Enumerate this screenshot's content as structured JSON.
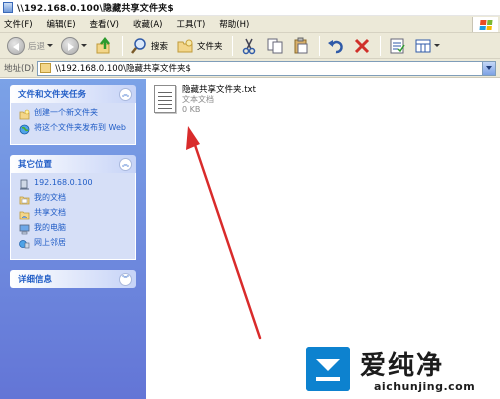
{
  "window": {
    "title": "\\\\192.168.0.100\\隐藏共享文件夹$"
  },
  "menu": [
    {
      "label": "文件(F)"
    },
    {
      "label": "编辑(E)"
    },
    {
      "label": "查看(V)"
    },
    {
      "label": "收藏(A)"
    },
    {
      "label": "工具(T)"
    },
    {
      "label": "帮助(H)"
    }
  ],
  "toolbar": {
    "back_label": "后退",
    "search_label": "搜索",
    "folders_label": "文件夹"
  },
  "address": {
    "label": "地址(D)",
    "value": "\\\\192.168.0.100\\隐藏共享文件夹$"
  },
  "taskpane": {
    "file_tasks": {
      "title": "文件和文件夹任务",
      "items": [
        {
          "label": "创建一个新文件夹"
        },
        {
          "label": "将这个文件夹发布到 Web"
        }
      ]
    },
    "other_places": {
      "title": "其它位置",
      "items": [
        {
          "label": "192.168.0.100"
        },
        {
          "label": "我的文档"
        },
        {
          "label": "共享文档"
        },
        {
          "label": "我的电脑"
        },
        {
          "label": "网上邻居"
        }
      ]
    },
    "details": {
      "title": "详细信息"
    }
  },
  "files": [
    {
      "name": "隐藏共享文件夹.txt",
      "type": "文本文档",
      "size": "0 KB"
    }
  ],
  "watermark": {
    "brand": "爱纯净",
    "url": "aichunjing.com"
  },
  "colors": {
    "taskpane_top": "#7ba2e7",
    "taskpane_bottom": "#6375d6",
    "link_blue": "#215dc6",
    "annotation_red": "#d92b2b",
    "watermark_blue": "#0d82cf"
  }
}
